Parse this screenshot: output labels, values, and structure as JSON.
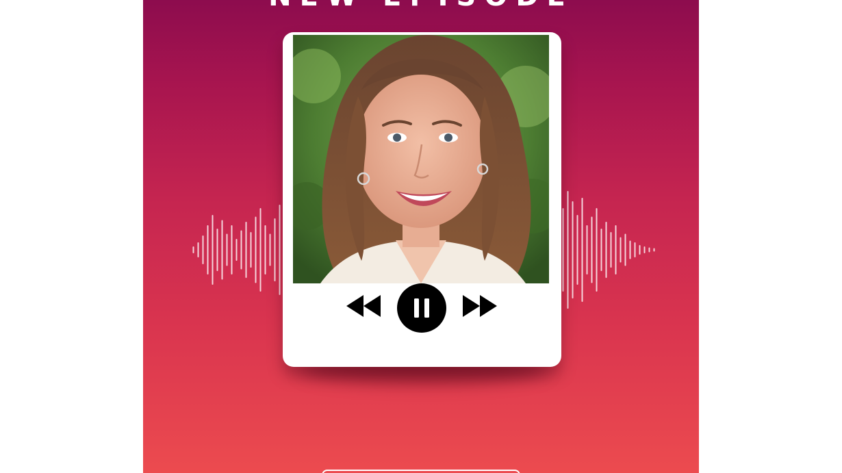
{
  "poster": {
    "headline": "NEW EPISODE",
    "colors": {
      "gradient_top": "#8d0c4e",
      "gradient_bottom": "#ec4b4f",
      "card": "#ffffff",
      "controls": "#000000"
    }
  },
  "player": {
    "state": "playing",
    "controls": [
      "rewind-icon",
      "pause-icon",
      "fast-forward-icon"
    ]
  }
}
